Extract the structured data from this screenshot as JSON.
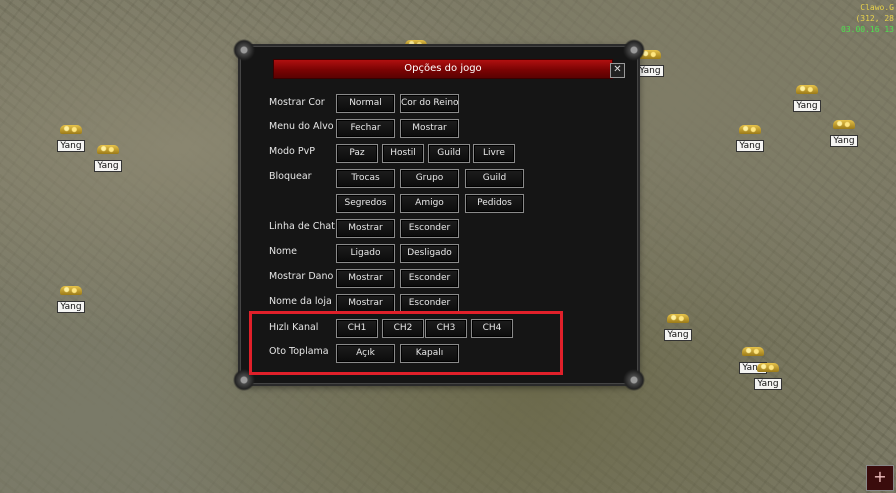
{
  "hud": {
    "name": "Clawo.G",
    "coords": "(312, 28",
    "clock": "03.00.16 13"
  },
  "drop_label": "Yang",
  "window": {
    "title": "Opções do jogo",
    "close_glyph": "✕",
    "rows": {
      "mostrar_cor": {
        "label": "Mostrar Cor",
        "buttons": [
          "Normal",
          "Cor do Reino"
        ]
      },
      "menu_alvo": {
        "label": "Menu do Alvo",
        "buttons": [
          "Fechar",
          "Mostrar"
        ]
      },
      "modo_pvp": {
        "label": "Modo PvP",
        "buttons": [
          "Paz",
          "Hostil",
          "Guild",
          "Livre"
        ]
      },
      "bloquear": {
        "label": "Bloquear",
        "buttons": [
          "Trocas",
          "Grupo",
          "Guild",
          "Segredos",
          "Amigo",
          "Pedidos"
        ]
      },
      "linha_chat": {
        "label": "Linha de Chat",
        "buttons": [
          "Mostrar",
          "Esconder"
        ]
      },
      "nome": {
        "label": "Nome",
        "buttons": [
          "Ligado",
          "Desligado"
        ]
      },
      "mostrar_dano": {
        "label": "Mostrar Dano",
        "buttons": [
          "Mostrar",
          "Esconder"
        ]
      },
      "nome_loja": {
        "label": "Nome da loja",
        "buttons": [
          "Mostrar",
          "Esconder"
        ]
      },
      "hizli_kanal": {
        "label": "Hızlı Kanal",
        "buttons": [
          "CH1",
          "CH2",
          "CH3",
          "CH4"
        ]
      },
      "oto_toplama": {
        "label": "Oto Toplama",
        "buttons": [
          "Açık",
          "Kapalı"
        ]
      }
    }
  },
  "colors": {
    "title_red": "#a00c0c",
    "highlight_red": "#e0202a",
    "hud_yellow": "#e8d24a",
    "hud_green": "#4fe04f"
  },
  "corner_icon": "+"
}
